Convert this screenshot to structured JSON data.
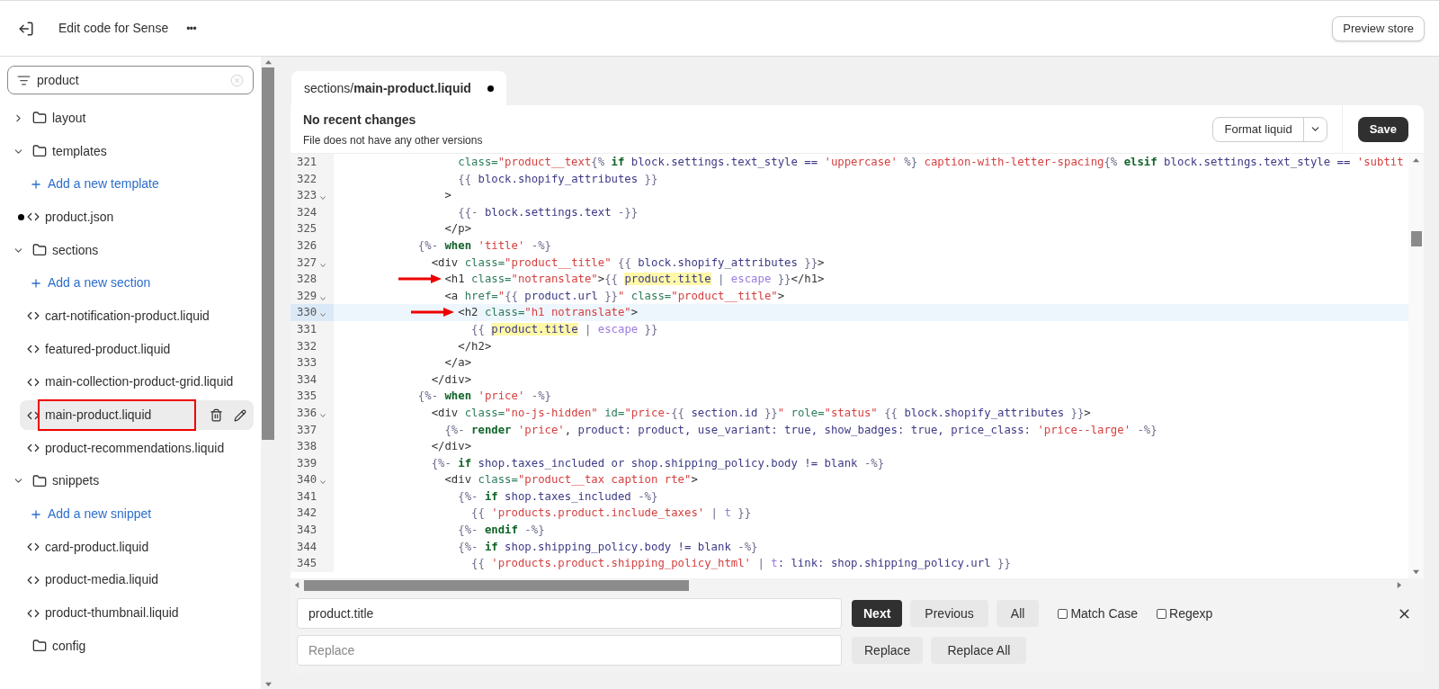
{
  "topbar": {
    "title": "Edit code for Sense",
    "more": "•••",
    "preview_button": "Preview store"
  },
  "sidebar": {
    "search": {
      "value": "product"
    },
    "items": [
      {
        "kind": "folder",
        "label": "layout",
        "expanded": false
      },
      {
        "kind": "folder",
        "label": "templates",
        "expanded": true,
        "children": [
          {
            "kind": "add",
            "label": "Add a new template"
          },
          {
            "kind": "file",
            "label": "product.json",
            "selected": false,
            "modified": true,
            "annotated": false
          }
        ]
      },
      {
        "kind": "folder",
        "label": "sections",
        "expanded": true,
        "children": [
          {
            "kind": "add",
            "label": "Add a new section"
          },
          {
            "kind": "file",
            "label": "cart-notification-product.liquid",
            "selected": false,
            "modified": false,
            "annotated": false
          },
          {
            "kind": "file",
            "label": "featured-product.liquid",
            "selected": false,
            "modified": false,
            "annotated": false
          },
          {
            "kind": "file",
            "label": "main-collection-product-grid.liquid",
            "selected": false,
            "modified": false,
            "annotated": false
          },
          {
            "kind": "file",
            "label": "main-product.liquid",
            "selected": true,
            "modified": false,
            "annotated": true
          },
          {
            "kind": "file",
            "label": "product-recommendations.liquid",
            "selected": false,
            "modified": false,
            "annotated": false
          }
        ]
      },
      {
        "kind": "folder",
        "label": "snippets",
        "expanded": true,
        "children": [
          {
            "kind": "add",
            "label": "Add a new snippet"
          },
          {
            "kind": "file",
            "label": "card-product.liquid",
            "selected": false,
            "modified": false,
            "annotated": false
          },
          {
            "kind": "file",
            "label": "product-media.liquid",
            "selected": false,
            "modified": false,
            "annotated": false
          },
          {
            "kind": "file",
            "label": "product-thumbnail.liquid",
            "selected": false,
            "modified": false,
            "annotated": false
          }
        ]
      },
      {
        "kind": "folder",
        "label": "config"
      }
    ]
  },
  "tab": {
    "folder": "sections/",
    "file": "main-product.liquid",
    "unsaved": true
  },
  "header": {
    "title": "No recent changes",
    "subtitle": "File does not have any other versions",
    "format_button": "Format liquid",
    "save_button": "Save"
  },
  "code": [
    {
      "n": "321",
      "fold": false,
      "active": false,
      "arrow": false,
      "tokens": [
        {
          "kind": "attr",
          "text": "                  class="
        },
        {
          "kind": "string",
          "text": "\"product__text"
        },
        {
          "kind": "delim",
          "text": "{% "
        },
        {
          "kind": "keyword",
          "text": "if"
        },
        {
          "kind": "var",
          "text": " block.settings.text_style == "
        },
        {
          "kind": "string",
          "text": "'uppercase'"
        },
        {
          "kind": "delim",
          "text": " %}"
        },
        {
          "kind": "string",
          "text": " caption-with-letter-spacing"
        },
        {
          "kind": "delim",
          "text": "{% "
        },
        {
          "kind": "keyword",
          "text": "elsif"
        },
        {
          "kind": "var",
          "text": " block.settings.text_style == "
        },
        {
          "kind": "string",
          "text": "'subtit"
        }
      ]
    },
    {
      "n": "322",
      "fold": false,
      "active": false,
      "arrow": false,
      "tokens": [
        {
          "kind": "delim",
          "text": "                  {{ "
        },
        {
          "kind": "var",
          "text": "block.shopify_attributes"
        },
        {
          "kind": "delim",
          "text": " }}"
        }
      ]
    },
    {
      "n": "323",
      "fold": true,
      "active": false,
      "arrow": false,
      "tokens": [
        {
          "kind": "plain",
          "text": "                >"
        }
      ]
    },
    {
      "n": "324",
      "fold": false,
      "active": false,
      "arrow": false,
      "tokens": [
        {
          "kind": "delim",
          "text": "                  {{- "
        },
        {
          "kind": "var",
          "text": "block.settings.text"
        },
        {
          "kind": "delim",
          "text": " -}}"
        }
      ]
    },
    {
      "n": "325",
      "fold": false,
      "active": false,
      "arrow": false,
      "tokens": [
        {
          "kind": "plain",
          "text": "                </p>"
        }
      ]
    },
    {
      "n": "326",
      "fold": false,
      "active": false,
      "arrow": false,
      "tokens": [
        {
          "kind": "delim",
          "text": "            {%- "
        },
        {
          "kind": "keyword",
          "text": "when"
        },
        {
          "kind": "string",
          "text": " 'title'"
        },
        {
          "kind": "delim",
          "text": " -%}"
        }
      ]
    },
    {
      "n": "327",
      "fold": true,
      "active": false,
      "arrow": false,
      "tokens": [
        {
          "kind": "plain",
          "text": "              <div "
        },
        {
          "kind": "attr",
          "text": "class="
        },
        {
          "kind": "string",
          "text": "\"product__title\""
        },
        {
          "kind": "delim",
          "text": " {{ "
        },
        {
          "kind": "var",
          "text": "block.shopify_attributes"
        },
        {
          "kind": "delim",
          "text": " }}"
        },
        {
          "kind": "plain",
          "text": ">"
        }
      ]
    },
    {
      "n": "328",
      "fold": false,
      "active": false,
      "arrow": true,
      "tokens": [
        {
          "kind": "plain",
          "text": "                <h1 "
        },
        {
          "kind": "attr",
          "text": "class="
        },
        {
          "kind": "string",
          "text": "\"notranslate\""
        },
        {
          "kind": "plain",
          "text": ">"
        },
        {
          "kind": "delim",
          "text": "{{ "
        },
        {
          "kind": "match",
          "text": "product.title"
        },
        {
          "kind": "delim",
          "text": " | "
        },
        {
          "kind": "filter",
          "text": "escape"
        },
        {
          "kind": "delim",
          "text": " }}"
        },
        {
          "kind": "plain",
          "text": "</h1>"
        }
      ]
    },
    {
      "n": "329",
      "fold": true,
      "active": false,
      "arrow": false,
      "tokens": [
        {
          "kind": "plain",
          "text": "                <a "
        },
        {
          "kind": "attr",
          "text": "href="
        },
        {
          "kind": "string",
          "text": "\""
        },
        {
          "kind": "delim",
          "text": "{{ "
        },
        {
          "kind": "var",
          "text": "product.url"
        },
        {
          "kind": "delim",
          "text": " }}"
        },
        {
          "kind": "string",
          "text": "\""
        },
        {
          "kind": "attr",
          "text": " class="
        },
        {
          "kind": "string",
          "text": "\"product__title\""
        },
        {
          "kind": "plain",
          "text": ">"
        }
      ]
    },
    {
      "n": "330",
      "fold": true,
      "active": true,
      "arrow": true,
      "tokens": [
        {
          "kind": "plain",
          "text": "                  <h2 "
        },
        {
          "kind": "attr",
          "text": "class="
        },
        {
          "kind": "string",
          "text": "\"h1 notranslate\""
        },
        {
          "kind": "plain",
          "text": ">"
        }
      ]
    },
    {
      "n": "331",
      "fold": false,
      "active": false,
      "arrow": false,
      "tokens": [
        {
          "kind": "delim",
          "text": "                    {{ "
        },
        {
          "kind": "match",
          "text": "product.title"
        },
        {
          "kind": "delim",
          "text": " | "
        },
        {
          "kind": "filter",
          "text": "escape"
        },
        {
          "kind": "delim",
          "text": " }}"
        }
      ]
    },
    {
      "n": "332",
      "fold": false,
      "active": false,
      "arrow": false,
      "tokens": [
        {
          "kind": "plain",
          "text": "                  </h2>"
        }
      ]
    },
    {
      "n": "333",
      "fold": false,
      "active": false,
      "arrow": false,
      "tokens": [
        {
          "kind": "plain",
          "text": "                </a>"
        }
      ]
    },
    {
      "n": "334",
      "fold": false,
      "active": false,
      "arrow": false,
      "tokens": [
        {
          "kind": "plain",
          "text": "              </div>"
        }
      ]
    },
    {
      "n": "335",
      "fold": false,
      "active": false,
      "arrow": false,
      "tokens": [
        {
          "kind": "delim",
          "text": "            {%- "
        },
        {
          "kind": "keyword",
          "text": "when"
        },
        {
          "kind": "string",
          "text": " 'price'"
        },
        {
          "kind": "delim",
          "text": " -%}"
        }
      ]
    },
    {
      "n": "336",
      "fold": true,
      "active": false,
      "arrow": false,
      "tokens": [
        {
          "kind": "plain",
          "text": "              <div "
        },
        {
          "kind": "attr",
          "text": "class="
        },
        {
          "kind": "string",
          "text": "\"no-js-hidden\""
        },
        {
          "kind": "attr",
          "text": " id="
        },
        {
          "kind": "string",
          "text": "\"price-"
        },
        {
          "kind": "delim",
          "text": "{{ "
        },
        {
          "kind": "var",
          "text": "section.id"
        },
        {
          "kind": "delim",
          "text": " }}"
        },
        {
          "kind": "string",
          "text": "\""
        },
        {
          "kind": "attr",
          "text": " role="
        },
        {
          "kind": "string",
          "text": "\"status\""
        },
        {
          "kind": "delim",
          "text": " {{ "
        },
        {
          "kind": "var",
          "text": "block.shopify_attributes"
        },
        {
          "kind": "delim",
          "text": " }}"
        },
        {
          "kind": "plain",
          "text": ">"
        }
      ]
    },
    {
      "n": "337",
      "fold": false,
      "active": false,
      "arrow": false,
      "tokens": [
        {
          "kind": "delim",
          "text": "                {%- "
        },
        {
          "kind": "keyword",
          "text": "render"
        },
        {
          "kind": "string",
          "text": " 'price'"
        },
        {
          "kind": "plain",
          "text": ", "
        },
        {
          "kind": "var",
          "text": "product: product, use_variant: true, show_badges: true, price_class: "
        },
        {
          "kind": "string",
          "text": "'price--large'"
        },
        {
          "kind": "delim",
          "text": " -%}"
        }
      ]
    },
    {
      "n": "338",
      "fold": false,
      "active": false,
      "arrow": false,
      "tokens": [
        {
          "kind": "plain",
          "text": "              </div>"
        }
      ]
    },
    {
      "n": "339",
      "fold": false,
      "active": false,
      "arrow": false,
      "tokens": [
        {
          "kind": "delim",
          "text": "              {%- "
        },
        {
          "kind": "keyword",
          "text": "if"
        },
        {
          "kind": "var",
          "text": " shop.taxes_included or shop.shipping_policy.body != blank"
        },
        {
          "kind": "delim",
          "text": " -%}"
        }
      ]
    },
    {
      "n": "340",
      "fold": true,
      "active": false,
      "arrow": false,
      "tokens": [
        {
          "kind": "plain",
          "text": "                <div "
        },
        {
          "kind": "attr",
          "text": "class="
        },
        {
          "kind": "string",
          "text": "\"product__tax caption rte\""
        },
        {
          "kind": "plain",
          "text": ">"
        }
      ]
    },
    {
      "n": "341",
      "fold": false,
      "active": false,
      "arrow": false,
      "tokens": [
        {
          "kind": "delim",
          "text": "                  {%- "
        },
        {
          "kind": "keyword",
          "text": "if"
        },
        {
          "kind": "var",
          "text": " shop.taxes_included"
        },
        {
          "kind": "delim",
          "text": " -%}"
        }
      ]
    },
    {
      "n": "342",
      "fold": false,
      "active": false,
      "arrow": false,
      "tokens": [
        {
          "kind": "delim",
          "text": "                    {{ "
        },
        {
          "kind": "string",
          "text": "'products.product.include_taxes'"
        },
        {
          "kind": "delim",
          "text": " | "
        },
        {
          "kind": "filter",
          "text": "t"
        },
        {
          "kind": "delim",
          "text": " }}"
        }
      ]
    },
    {
      "n": "343",
      "fold": false,
      "active": false,
      "arrow": false,
      "tokens": [
        {
          "kind": "delim",
          "text": "                  {%- "
        },
        {
          "kind": "keyword",
          "text": "endif"
        },
        {
          "kind": "delim",
          "text": " -%}"
        }
      ]
    },
    {
      "n": "344",
      "fold": false,
      "active": false,
      "arrow": false,
      "tokens": [
        {
          "kind": "delim",
          "text": "                  {%- "
        },
        {
          "kind": "keyword",
          "text": "if"
        },
        {
          "kind": "var",
          "text": " shop.shipping_policy.body != blank"
        },
        {
          "kind": "delim",
          "text": " -%}"
        }
      ]
    },
    {
      "n": "345",
      "fold": false,
      "active": false,
      "arrow": false,
      "tokens": [
        {
          "kind": "delim",
          "text": "                    {{ "
        },
        {
          "kind": "string",
          "text": "'products.product.shipping_policy_html'"
        },
        {
          "kind": "delim",
          "text": " | "
        },
        {
          "kind": "filter",
          "text": "t"
        },
        {
          "kind": "var",
          "text": ": link: shop.shipping_policy.url"
        },
        {
          "kind": "delim",
          "text": " }}"
        }
      ]
    }
  ],
  "find": {
    "search_value": "product.title",
    "replace_placeholder": "Replace",
    "next": "Next",
    "previous": "Previous",
    "all": "All",
    "replace": "Replace",
    "replace_all": "Replace All",
    "options": [
      {
        "label": "Match Case",
        "checked": false
      },
      {
        "label": "Regexp",
        "checked": false
      }
    ]
  }
}
